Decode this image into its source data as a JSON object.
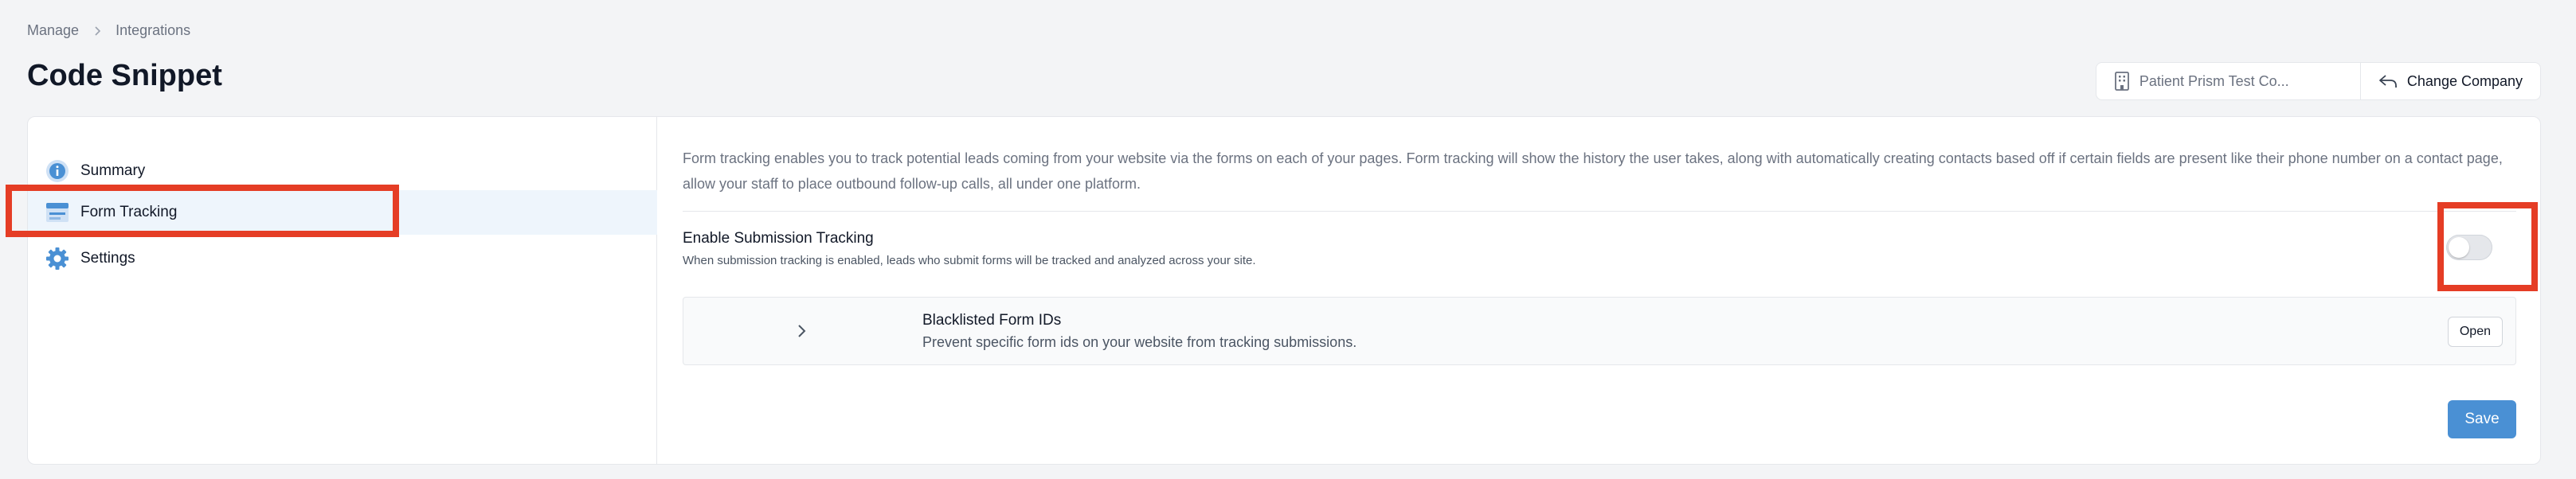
{
  "breadcrumb": {
    "items": [
      "Manage",
      "Integrations"
    ]
  },
  "page": {
    "title": "Code Snippet"
  },
  "company": {
    "name": "Patient Prism Test Co...",
    "change_label": "Change Company"
  },
  "sidebar": {
    "items": [
      {
        "label": "Summary",
        "icon": "info-icon"
      },
      {
        "label": "Form Tracking",
        "icon": "form-icon",
        "active": true
      },
      {
        "label": "Settings",
        "icon": "gear-icon"
      }
    ]
  },
  "main": {
    "intro": "Form tracking enables you to track potential leads coming from your website via the forms on each of your pages. Form tracking will show the history the user takes, along with automatically creating contacts based off if certain fields are present like their phone number on a contact page, allow your staff to place outbound follow-up calls, all under one platform.",
    "submission_tracking": {
      "title": "Enable Submission Tracking",
      "description": "When submission tracking is enabled, leads who submit forms will be tracked and analyzed across your site.",
      "enabled": false
    },
    "blacklist": {
      "title": "Blacklisted Form IDs",
      "description": "Prevent specific form ids on your website from tracking submissions.",
      "open_label": "Open"
    },
    "save_label": "Save"
  },
  "colors": {
    "accent": "#4a90d4",
    "highlight": "#e53d25",
    "active_bg": "#eef5fc"
  }
}
